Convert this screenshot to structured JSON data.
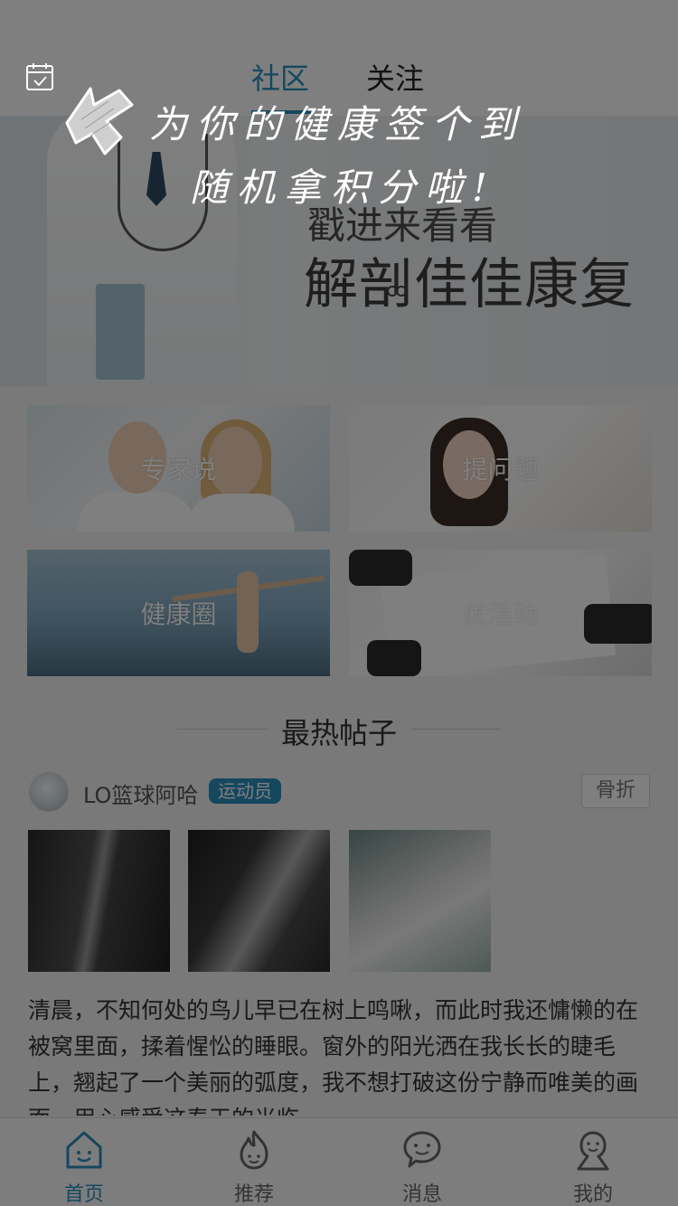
{
  "header": {
    "tabs": [
      {
        "label": "社区",
        "active": true
      },
      {
        "label": "关注",
        "active": false
      }
    ],
    "calendar_icon": "calendar-check-icon"
  },
  "banner": {
    "line1": "戳进来看看",
    "line2": "解剖佳佳康复"
  },
  "grid": {
    "items": [
      {
        "label": "专家说"
      },
      {
        "label": "提问题"
      },
      {
        "label": "健康圈"
      },
      {
        "label": "优活动"
      }
    ]
  },
  "hot_posts": {
    "title": "最热帖子",
    "post": {
      "username": "LO篮球阿哈",
      "badge": "运动员",
      "tag": "骨折",
      "text": "清晨，不知何处的鸟儿早已在树上鸣啾，而此时我还慵懒的在被窝里面，揉着惺忪的睡眼。窗外的阳光洒在我长长的睫毛上，翘起了一个美丽的弧度，我不想打破这份宁静而唯美的画面，用心感受这春天的光临。"
    }
  },
  "guide": {
    "line1": "为你的健康签个到",
    "line2": "随机拿积分啦!"
  },
  "bottom_nav": {
    "items": [
      {
        "label": "首页",
        "icon": "home-icon",
        "active": true
      },
      {
        "label": "推荐",
        "icon": "flame-icon",
        "active": false
      },
      {
        "label": "消息",
        "icon": "chat-icon",
        "active": false
      },
      {
        "label": "我的",
        "icon": "user-icon",
        "active": false
      }
    ]
  },
  "colors": {
    "accent": "#2a8fbd",
    "overlay": "rgba(0,0,0,0.5)"
  }
}
